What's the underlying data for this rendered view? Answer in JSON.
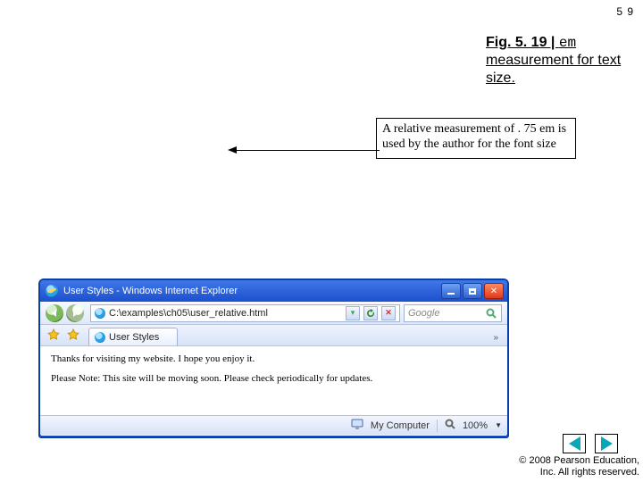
{
  "page_number": "5 9",
  "caption": {
    "fig": "Fig. 5. 19",
    "pipe": " | ",
    "em": "em",
    "rest": " measurement for text size."
  },
  "note": "A relative measurement of . 75 em is used by the author for the font size",
  "browser": {
    "title": "User Styles - Windows Internet Explorer",
    "address": "C:\\examples\\ch05\\user_relative.html",
    "search_placeholder": "Google",
    "tab_label": "User Styles",
    "chevron": "»",
    "body_line1": "Thanks for visiting my website. I hope you enjoy it.",
    "body_line2": "Please Note: This site will be moving soon. Please check periodically for updates.",
    "status_zone": "My Computer",
    "zoom": "100%"
  },
  "copyright": {
    "line1": "© 2008 Pearson Education,",
    "line2": "Inc.  All rights reserved."
  }
}
